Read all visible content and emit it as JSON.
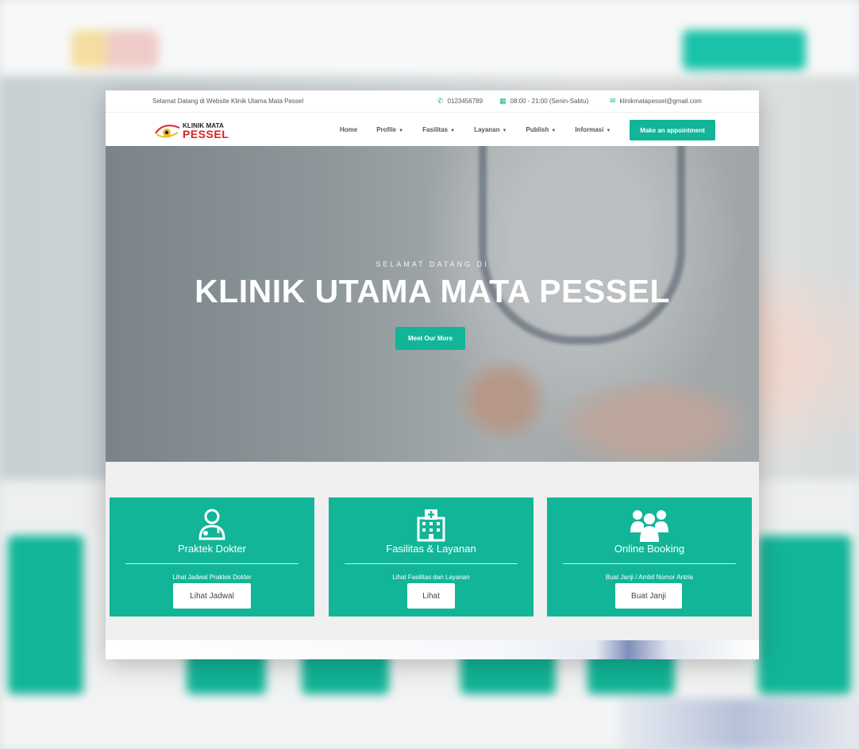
{
  "topbar": {
    "welcome": "Selamat Datang di Website Klinik Utama Mata Pessel",
    "phone": "0123456789",
    "hours": "08:00 - 21:00 (Senin-Sabtu)",
    "email": "klinikmatapessel@gmail.com"
  },
  "logo": {
    "line1": "KLINIK MATA",
    "line2": "PESSEL"
  },
  "nav": {
    "items": [
      "Home",
      "Profile",
      "Fasilitas",
      "Layanan",
      "Publish",
      "Informasi"
    ],
    "cta": "Make an appointment"
  },
  "hero": {
    "kicker": "SELAMAT DATANG DI",
    "title": "KLINIK UTAMA MATA PESSEL",
    "button": "Meet Our More",
    "slides": 2,
    "active_slide": 1
  },
  "cards": [
    {
      "icon": "doctor-icon",
      "title": "Praktek Dokter",
      "subtitle": "Lihat Jadwal Praktek Dokter",
      "button": "Lihat Jadwal"
    },
    {
      "icon": "hospital-icon",
      "title": "Fasilitas & Layanan",
      "subtitle": "Lihat Fasilitas dan Layanan",
      "button": "Lihat"
    },
    {
      "icon": "group-icon",
      "title": "Online Booking",
      "subtitle": "Buat Janji / Ambil Nomor Antria",
      "button": "Buat Janji"
    }
  ],
  "colors": {
    "accent": "#12b597",
    "logo_red": "#d4242a",
    "logo_yellow": "#f0b92c"
  }
}
